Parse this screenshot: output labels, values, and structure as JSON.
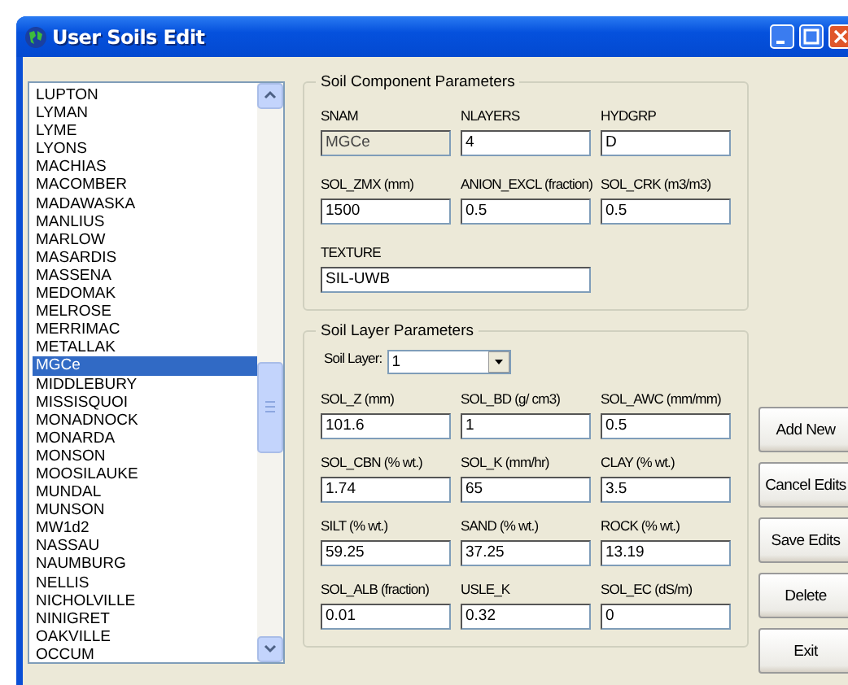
{
  "window": {
    "title": "User Soils Edit"
  },
  "soil_list": {
    "items": [
      {
        "name": "LUPTON",
        "selected": false
      },
      {
        "name": "LYMAN",
        "selected": false
      },
      {
        "name": "LYME",
        "selected": false
      },
      {
        "name": "LYONS",
        "selected": false
      },
      {
        "name": "MACHIAS",
        "selected": false
      },
      {
        "name": "MACOMBER",
        "selected": false
      },
      {
        "name": "MADAWASKA",
        "selected": false
      },
      {
        "name": "MANLIUS",
        "selected": false
      },
      {
        "name": "MARLOW",
        "selected": false
      },
      {
        "name": "MASARDIS",
        "selected": false
      },
      {
        "name": "MASSENA",
        "selected": false
      },
      {
        "name": "MEDOMAK",
        "selected": false
      },
      {
        "name": "MELROSE",
        "selected": false
      },
      {
        "name": "MERRIMAC",
        "selected": false
      },
      {
        "name": "METALLAK",
        "selected": false
      },
      {
        "name": "MGCe",
        "selected": true
      },
      {
        "name": "MIDDLEBURY",
        "selected": false
      },
      {
        "name": "MISSISQUOI",
        "selected": false
      },
      {
        "name": "MONADNOCK",
        "selected": false
      },
      {
        "name": "MONARDA",
        "selected": false
      },
      {
        "name": "MONSON",
        "selected": false
      },
      {
        "name": "MOOSILAUKE",
        "selected": false
      },
      {
        "name": "MUNDAL",
        "selected": false
      },
      {
        "name": "MUNSON",
        "selected": false
      },
      {
        "name": "MW1d2",
        "selected": false
      },
      {
        "name": "NASSAU",
        "selected": false
      },
      {
        "name": "NAUMBURG",
        "selected": false
      },
      {
        "name": "NELLIS",
        "selected": false
      },
      {
        "name": "NICHOLVILLE",
        "selected": false
      },
      {
        "name": "NINIGRET",
        "selected": false
      },
      {
        "name": "OAKVILLE",
        "selected": false
      },
      {
        "name": "OCCUM",
        "selected": false
      }
    ]
  },
  "soil_component": {
    "title": "Soil Component Parameters",
    "fields": [
      {
        "label": "SNAM",
        "value": "MGCe",
        "disabled": true
      },
      {
        "label": "NLAYERS",
        "value": "4",
        "disabled": false
      },
      {
        "label": "HYDGRP",
        "value": "D",
        "disabled": false
      },
      {
        "label": "SOL_ZMX (mm)",
        "value": "1500",
        "disabled": false
      },
      {
        "label": "ANION_EXCL (fraction)",
        "value": "0.5",
        "disabled": false
      },
      {
        "label": "SOL_CRK (m3/m3)",
        "value": "0.5",
        "disabled": false
      }
    ],
    "texture": {
      "label": "TEXTURE",
      "value": "SIL-UWB"
    }
  },
  "soil_layer": {
    "title": "Soil Layer Parameters",
    "layer_select": {
      "label": "Soil Layer:",
      "value": "1"
    },
    "fields": [
      {
        "label": "SOL_Z (mm)",
        "value": "101.6"
      },
      {
        "label": "SOL_BD (g/ cm3)",
        "value": "1"
      },
      {
        "label": "SOL_AWC (mm/mm)",
        "value": "0.5"
      },
      {
        "label": "SOL_CBN (% wt.)",
        "value": "1.74"
      },
      {
        "label": "SOL_K (mm/hr)",
        "value": "65"
      },
      {
        "label": "CLAY (% wt.)",
        "value": "3.5"
      },
      {
        "label": "SILT (% wt.)",
        "value": "59.25"
      },
      {
        "label": "SAND (% wt.)",
        "value": "37.25"
      },
      {
        "label": "ROCK (% wt.)",
        "value": "13.19"
      },
      {
        "label": "SOL_ALB (fraction)",
        "value": "0.01"
      },
      {
        "label": "USLE_K",
        "value": "0.32"
      },
      {
        "label": "SOL_EC (dS/m)",
        "value": "0"
      }
    ]
  },
  "buttons": [
    "Add New",
    "Cancel Edits",
    "Save Edits",
    "Delete",
    "Exit"
  ]
}
